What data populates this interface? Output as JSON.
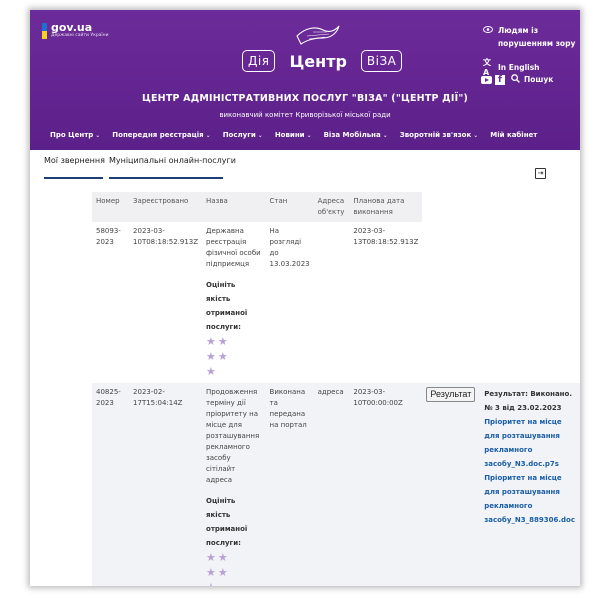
{
  "gov": {
    "title": "gov.ua",
    "subtitle": "Державні сайти України"
  },
  "logo": {
    "left": "Дія",
    "center": "Центр",
    "right": "ВіЗА"
  },
  "org": {
    "title": "ЦЕНТР АДМІНІСТРАТИВНИХ ПОСЛУГ \"ВІЗА\" (\"ЦЕНТР ДІЇ\")",
    "subtitle": "виконавчий комітет Криворізької міської ради"
  },
  "top_right": {
    "accessibility_line1": "Людям із",
    "accessibility_line2": "порушенням зору",
    "english": "In English",
    "search": "Пошук"
  },
  "nav": [
    {
      "label": "Про Центр",
      "has_menu": true
    },
    {
      "label": "Попередня реєстрація",
      "has_menu": true
    },
    {
      "label": "Послуги",
      "has_menu": true
    },
    {
      "label": "Новини",
      "has_menu": true
    },
    {
      "label": "Віза Мобільна",
      "has_menu": true
    },
    {
      "label": "Зворотній зв'язок",
      "has_menu": true
    },
    {
      "label": "Мій кабінет",
      "has_menu": false
    }
  ],
  "tabs": {
    "my_requests": "Мої звернення",
    "municipal": "Муніципальні онлайн-послуги"
  },
  "table": {
    "headers": {
      "number": "Номер",
      "registered": "Зареєстровано",
      "name": "Назва",
      "status": "Стан",
      "address": "Адреса об'єкту",
      "planned": "Планова дата виконання"
    },
    "rate_label": "Оцініть якість отриманої послуги:",
    "rows": [
      {
        "number": "58093-2023",
        "registered": "2023-03-10T08:18:52.913Z",
        "name": "Державна реєстрація фізичної особи підприємця",
        "status": "На розгляді до 13.03.2023",
        "address": "",
        "planned": "2023-03-13T08:18:52.913Z"
      },
      {
        "number": "40825-2023",
        "registered": "2023-02-17T15:04:14Z",
        "name": "Продовження терміну дії пріоритету на місце для розташування рекламного засобу сітілайт адреса",
        "status": "Виконана та передана на портал",
        "address": "адреса",
        "planned": "2023-03-10T00:00:00Z",
        "button": "Результат",
        "result": "Результат: Виконано. № 3 від 23.02.2023",
        "files": [
          "Пріоритет на місце для розташування рекламного засобу_N3.doc.p7s",
          "Пріоритет на місце для розташування рекламного засобу_N3_889306.doc"
        ]
      }
    ]
  },
  "colors": {
    "header": "#6c2b9a",
    "link": "#1a5ea8",
    "star": "#b9a1d6",
    "tab_underline": "#1d3f73"
  }
}
